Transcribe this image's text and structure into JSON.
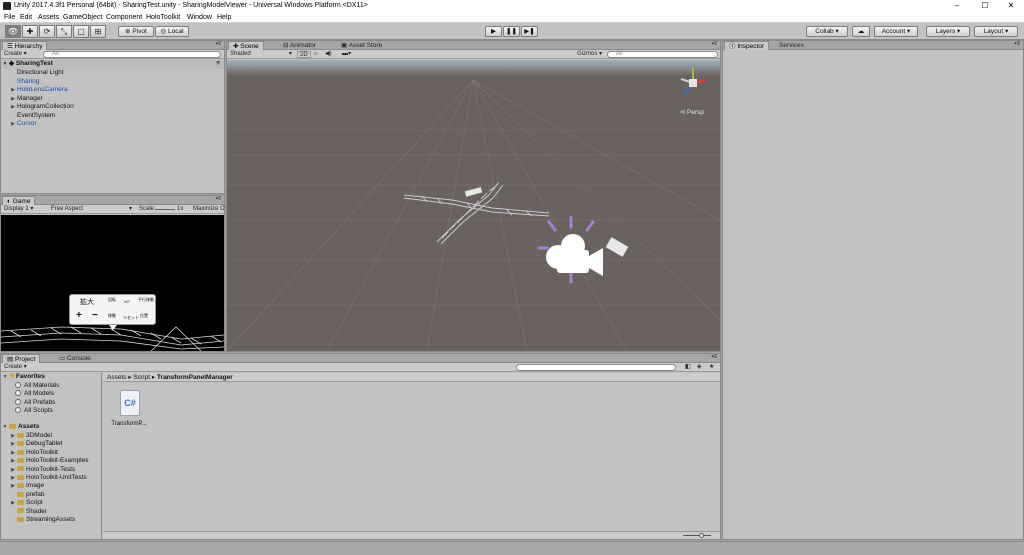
{
  "window": {
    "title": "Unity 2017.4.3f1 Personal (64bit) - SharingTest.unity - SharingModelViewer - Universal Windows Platform <DX11>",
    "minimize": "–",
    "maximize": "☐",
    "close": "✕"
  },
  "menu": [
    "File",
    "Edit",
    "Assets",
    "GameObject",
    "Component",
    "HoloToolkit",
    "Window",
    "Help"
  ],
  "toolbar": {
    "pivot": "Pivot",
    "local": "Local",
    "collab": "Collab ▾",
    "account": "Account",
    "layers": "Layers",
    "layout": "Layout"
  },
  "hierarchy": {
    "tab": "Hierarchy",
    "create": "Create ▾",
    "search_placeholder": "All",
    "scene": "SharingTest",
    "items": [
      {
        "label": "Directional Light",
        "expand": "",
        "prefab": false
      },
      {
        "label": "Sharing",
        "expand": "",
        "prefab": true
      },
      {
        "label": "HoloLensCamera",
        "expand": "▶",
        "prefab": true
      },
      {
        "label": "Manager",
        "expand": "▶",
        "prefab": false
      },
      {
        "label": "HologramCollection",
        "expand": "▶",
        "prefab": false
      },
      {
        "label": "EventSystem",
        "expand": "",
        "prefab": false
      },
      {
        "label": "Cursor",
        "expand": "▶",
        "prefab": true
      }
    ]
  },
  "game": {
    "tab": "Game",
    "display": "Display 1",
    "aspect": "Free Aspect",
    "scale_label": "Scale",
    "scale_value": "1x",
    "maximize": "Maximize O",
    "popup_title": "拡大",
    "popup_plus": "+",
    "popup_minus": "−",
    "popup_cells": [
      "回転",
      "±0°",
      "平行移動",
      "移動",
      "リセット",
      "位置"
    ]
  },
  "scene": {
    "tabs": [
      "Scene",
      "Animator",
      "Asset Store"
    ],
    "shading": "Shaded",
    "mode2d": "2D",
    "gizmos": "Gizmos ▾",
    "search_placeholder": "All",
    "persp": "Persp"
  },
  "inspector": {
    "tabs": [
      "Inspector",
      "Services"
    ]
  },
  "project": {
    "tabs": [
      "Project",
      "Console"
    ],
    "create": "Create ▾",
    "breadcrumb": [
      "Assets",
      "Script",
      "TransformPanelManager"
    ],
    "favorites_label": "Favorites",
    "favorites": [
      "All Materials",
      "All Models",
      "All Prefabs",
      "All Scripts"
    ],
    "assets_label": "Assets",
    "folders": [
      {
        "label": "3DModel",
        "expand": "▶"
      },
      {
        "label": "DebugTablet",
        "expand": "▶"
      },
      {
        "label": "HoloToolkit",
        "expand": "▶"
      },
      {
        "label": "HoloToolkit-Examples",
        "expand": "▶"
      },
      {
        "label": "HoloToolkit-Tests",
        "expand": "▶"
      },
      {
        "label": "HoloToolkit-UnitTests",
        "expand": "▶"
      },
      {
        "label": "Image",
        "expand": "▶"
      },
      {
        "label": "prefab",
        "expand": ""
      },
      {
        "label": "Script",
        "expand": "▶"
      },
      {
        "label": "Shader",
        "expand": ""
      },
      {
        "label": "StreamingAssets",
        "expand": ""
      }
    ],
    "file": {
      "name": "TransformP...",
      "icon": "C#"
    }
  },
  "colors": {
    "scene_bg": "#6a625f",
    "scene_sky": "#9fb4bd",
    "camera_gizmo": "#a77fd6",
    "prefab_blue": "#1f4fa8"
  }
}
